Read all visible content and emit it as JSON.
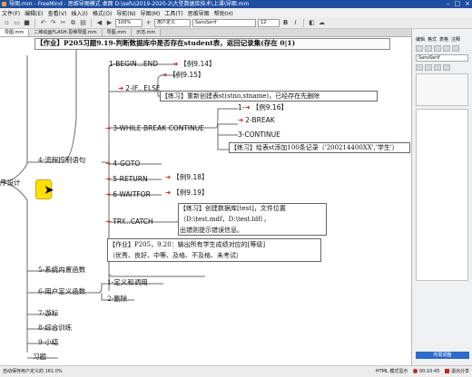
{
  "window": {
    "title": "导图.mm - FreeMind - 思维导图模式 桌面 D:\\sefu\\2019-2020-2\\大型数据库技术\\上课\\导图.mm"
  },
  "menubar": {
    "items": [
      "文件(F)",
      "编辑(E)",
      "查看(V)",
      "插入(I)",
      "格式(O)",
      "导航(N)",
      "导图(M)",
      "工具(T)",
      "思维导图",
      "帮助(H)"
    ]
  },
  "toolbar": {
    "zoom_value": "100%",
    "node_style_value": "用户定义",
    "font_value": "SansSerif",
    "font_size_value": "12"
  },
  "tabs": [
    {
      "label": "导图.mm"
    },
    {
      "label": "二维动画FLASH-思维导图.mm"
    },
    {
      "label": "导图.mm"
    },
    {
      "label": "示范.mm"
    }
  ],
  "mindmap": {
    "root_label": "序设计",
    "task_top": "【作业】P205习题9.19-判断数据库中是否存在student表，返回记录集(存在 0|1)",
    "n1": {
      "label": "1-BEGIN...END",
      "ref": "【例9.14】"
    },
    "n2": {
      "label": "2-IF...ELSE",
      "ref": "【例9.15】",
      "practice": "【练习】重新创建表st(stno,stname)，已经存在先删除"
    },
    "n3": {
      "label": "3-WHILE BREAK CONTINUE",
      "c1": "1-",
      "c1_ref": "【例9.16】",
      "c2": "2-BREAK",
      "c3": "3-CONTINUE",
      "practice": "【练习】给表st添加100条记录（'200214400XX','学生'）"
    },
    "n4": {
      "label": "4-GOTO"
    },
    "n5": {
      "label": "5-RETURN",
      "ref": "【例9.18】"
    },
    "n6": {
      "label": "6-WAITFOR",
      "ref": "【例9.19】"
    },
    "n7": {
      "label": "TRY...CATCH",
      "practice_l1": "【练习】创建数据库[test]，文件位置",
      "practice_l2": "（D:\\test.mdf，D:\\test.ldf），",
      "practice_l3": "出错则提示错误信息。"
    },
    "task_bottom_l1": "【作业】P205，9.20：输出所有学生成绩对应的[等级]",
    "task_bottom_l2": "（优秀、良好、中等、及格、不及格、未考试）",
    "flow_label": "4-流程控制语句",
    "b5": "5-系统内置函数",
    "b6": "6-用户定义函数",
    "b6c1": "1-定义和调用",
    "b6c2": "2-删除",
    "b7": "7-游标",
    "b8": "8-综合训练",
    "b9": "9-小结",
    "b10": "习题"
  },
  "sidepanel": {
    "tabs": [
      "编辑",
      "格式",
      "表格",
      "注释"
    ],
    "font_value": "SansSerif",
    "bottom_button": "布局调整"
  },
  "statusbar": {
    "text": "自动保存用户定义的 161.0%",
    "rec_time": "00:10:45",
    "stop_label": "退出分享",
    "extra": "HTML 模式显示"
  },
  "colors": {
    "accent": "#1f4ea1",
    "highlight": "#ffe100",
    "arrow": "#d02020"
  }
}
